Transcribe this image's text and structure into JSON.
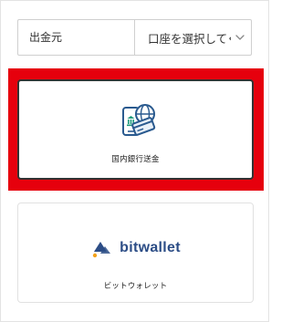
{
  "source_select": {
    "label": "出金元",
    "value": "口座を選択してく",
    "icon": "chevron-down-icon"
  },
  "methods": [
    {
      "label": "国内銀行送金",
      "icon": "bank-transfer-icon",
      "selected": true,
      "highlight_color": "#e6000d"
    },
    {
      "label": "ビットウォレット",
      "logo_text": "bitwallet",
      "icon": "bitwallet-logo-icon",
      "brand_color": "#2c4d86"
    }
  ]
}
